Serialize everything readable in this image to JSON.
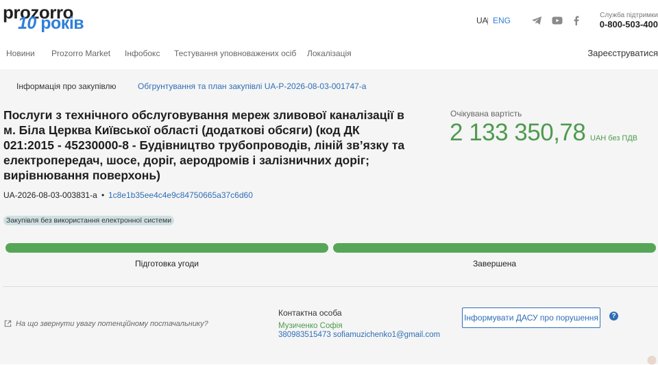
{
  "header": {
    "logo_top": "prozorro",
    "logo_bottom_num": "10",
    "logo_bottom_word": "років",
    "lang": {
      "ua": "UA",
      "separator": "|",
      "eng": "ENG"
    },
    "support": {
      "label": "Служба підтримки",
      "phone": "0-800-503-400"
    }
  },
  "nav": {
    "items": [
      "Новини",
      "Prozorro Market",
      "Інфобокс",
      "Тестування уповноважених осіб",
      "Локалізація"
    ],
    "register": "Зареєструватися"
  },
  "tabs": {
    "info": "Інформація про закупівлю",
    "plan_link": "Обгрунтування та план закупівлі UA-P-2026-08-03-001747-a"
  },
  "tender": {
    "title": "Послуги з технічного обслуговування мереж зливової каналізації в м. Біла Церква Київської області (додаткові обсяги) (код ДК 021:2015 - 45230000-8 - Будівництво трубопроводів, ліній зв’язку та електропередач, шосе, доріг, аеродромів і залізничних доріг; вирівнювання поверхонь)",
    "id": "UA-2026-08-03-003831-a",
    "bullet": "•",
    "hash": "1c8e1b35ee4c4e9c84750665a37c6d60",
    "badge": "Закупівля без використання електронної системи",
    "expected_label": "Очікувана вартість",
    "expected_amount": "2 133 350,78",
    "expected_currency": "UAH без ПДВ"
  },
  "stages": [
    {
      "label": "Підготовка угоди",
      "progress": 1.0
    },
    {
      "label": "Завершена",
      "progress": 1.0
    }
  ],
  "footer": {
    "hint": "На що звернути увагу потенційному постачальнику?",
    "contact_label": "Контактна особа",
    "contact_name": "Музиченко Софія",
    "contact_info": "380983515473 sofiamuzichenko1@gmail.com",
    "report_button": "Інформувати ДАСУ про порушення",
    "help": "?"
  },
  "colors": {
    "accent_blue": "#2f6db5",
    "logo_blue": "#2f7fd8",
    "green": "#57a657",
    "badge_bg": "#cfe0e3"
  }
}
